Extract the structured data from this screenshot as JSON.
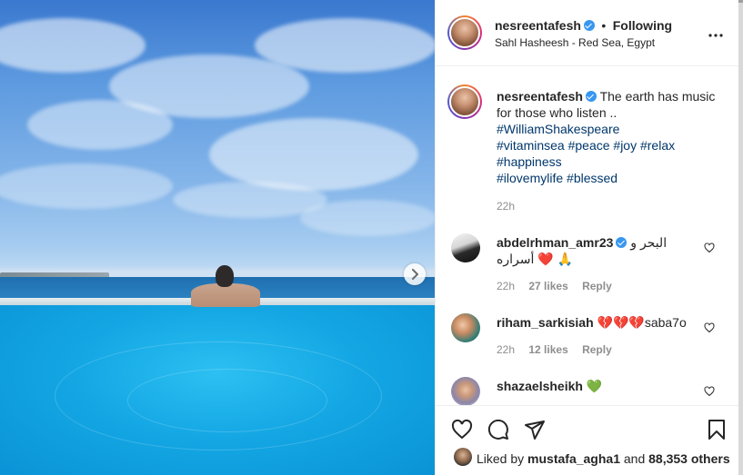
{
  "post": {
    "username": "nesreentafesh",
    "follow_status": "Following",
    "separator": "•",
    "location": "Sahl Hasheesh - Red Sea, Egypt"
  },
  "caption": {
    "username": "nesreentafesh",
    "text": "The earth has music for those who listen ..",
    "hashtags": [
      "#WilliamShakespeare",
      "#vitaminsea #peace #joy #relax",
      "#happiness",
      "#ilovemylife #blessed"
    ],
    "time": "22h"
  },
  "comments": [
    {
      "username": "abdelrhman_amr23",
      "verified": true,
      "text": "البحر و أسراره",
      "emoji": "❤️ 🙏",
      "time": "22h",
      "likes": "27 likes",
      "reply": "Reply"
    },
    {
      "username": "riham_sarkisiah",
      "verified": false,
      "text": "saba7o",
      "emoji": "💔💔💔",
      "time": "22h",
      "likes": "12 likes",
      "reply": "Reply"
    },
    {
      "username": "shazaelsheikh",
      "verified": false,
      "text": "",
      "emoji": "💚"
    }
  ],
  "likes_bar": {
    "prefix": "Liked by",
    "user": "mustafa_agha1",
    "middle": "and",
    "others": "88,353 others"
  },
  "icons": {
    "more": "more-options-icon",
    "next": "chevron-right-icon",
    "like": "heart-icon",
    "comment": "comment-icon",
    "share": "paper-plane-icon",
    "save": "bookmark-icon"
  },
  "colors": {
    "link": "#00376b",
    "verified": "#3897f0",
    "secondary": "#8e8e8e",
    "green_heart": "#34c400",
    "red_heart": "#e0245e"
  }
}
